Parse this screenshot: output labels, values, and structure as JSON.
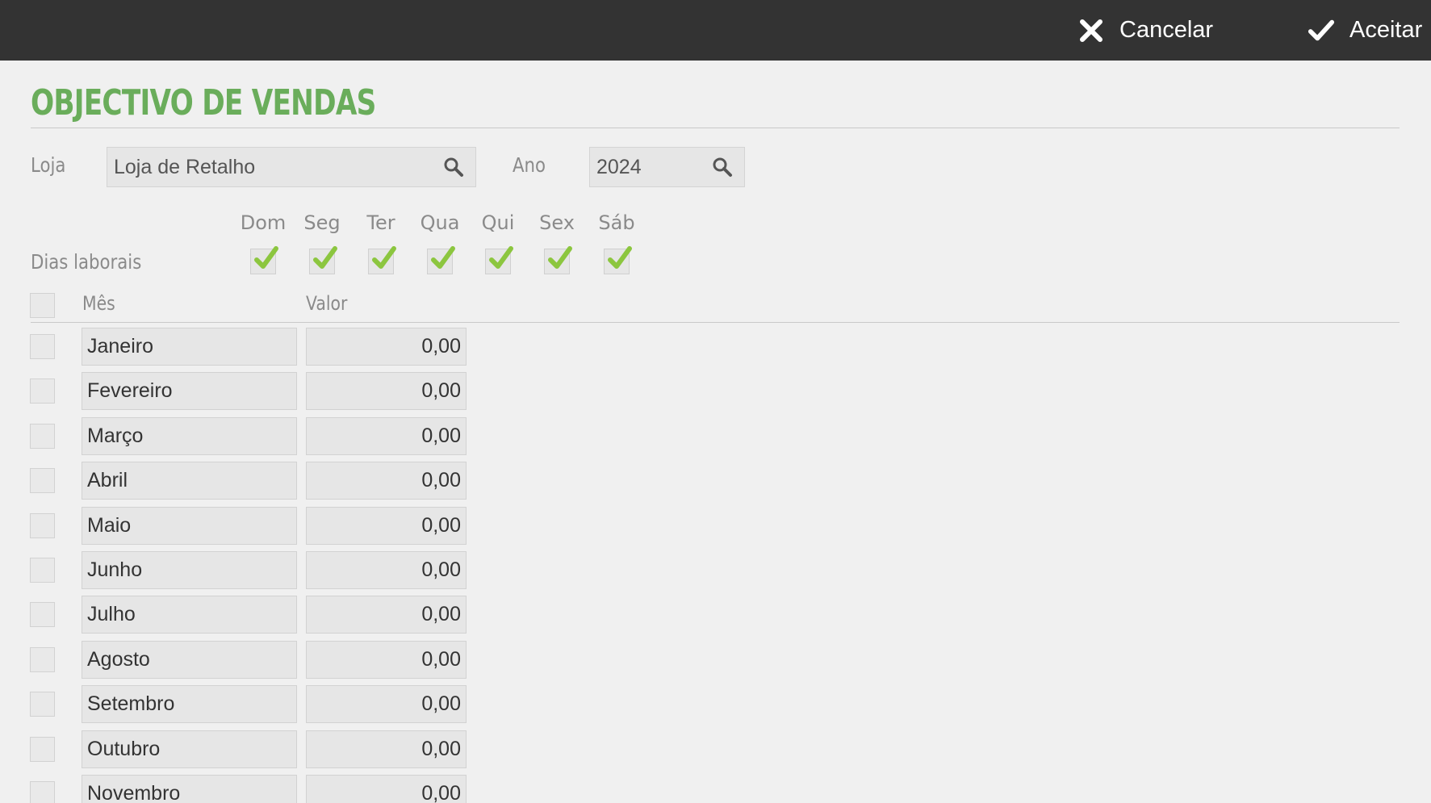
{
  "toolbar": {
    "cancel_label": "Cancelar",
    "accept_label": "Aceitar"
  },
  "page": {
    "title": "OBJECTIVO DE VENDAS"
  },
  "form": {
    "store_label": "Loja",
    "store_value": "Loja de Retalho",
    "year_label": "Ano",
    "year_value": "2024",
    "workdays_label": "Dias laborais"
  },
  "days": [
    {
      "label": "Dom",
      "checked": true
    },
    {
      "label": "Seg",
      "checked": true
    },
    {
      "label": "Ter",
      "checked": true
    },
    {
      "label": "Qua",
      "checked": true
    },
    {
      "label": "Qui",
      "checked": true
    },
    {
      "label": "Sex",
      "checked": true
    },
    {
      "label": "Sáb",
      "checked": true
    }
  ],
  "table": {
    "month_header": "Mês",
    "value_header": "Valor",
    "rows": [
      {
        "month": "Janeiro",
        "value": "0,00"
      },
      {
        "month": "Fevereiro",
        "value": "0,00"
      },
      {
        "month": "Março",
        "value": "0,00"
      },
      {
        "month": "Abril",
        "value": "0,00"
      },
      {
        "month": "Maio",
        "value": "0,00"
      },
      {
        "month": "Junho",
        "value": "0,00"
      },
      {
        "month": "Julho",
        "value": "0,00"
      },
      {
        "month": "Agosto",
        "value": "0,00"
      },
      {
        "month": "Setembro",
        "value": "0,00"
      },
      {
        "month": "Outubro",
        "value": "0,00"
      },
      {
        "month": "Novembro",
        "value": "0,00"
      }
    ]
  },
  "colors": {
    "accent": "#6aad5b",
    "check": "#8cc63f",
    "topbar": "#333333"
  }
}
